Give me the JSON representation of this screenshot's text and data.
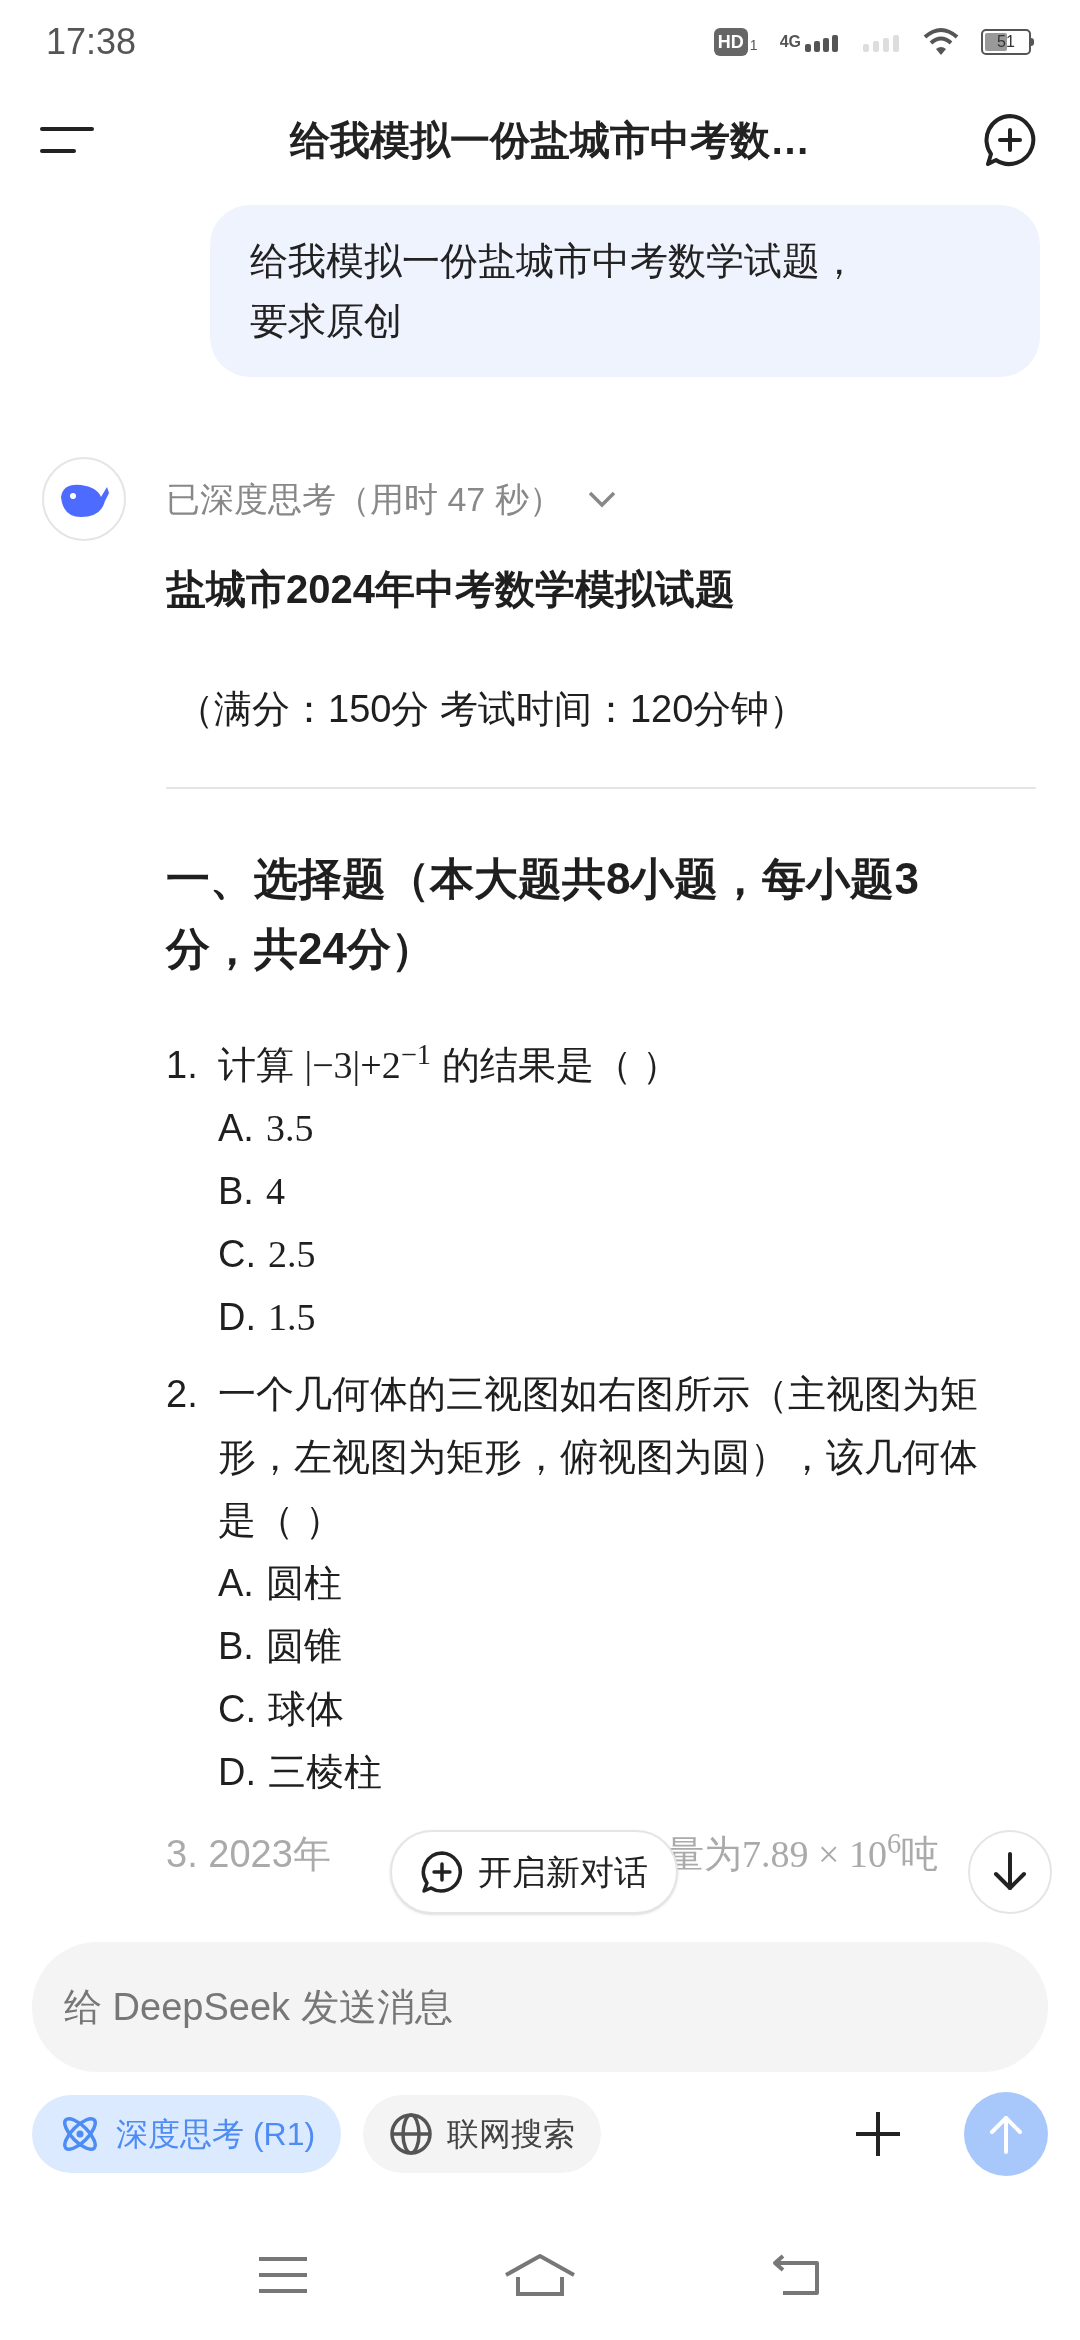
{
  "status_bar": {
    "time": "17:38",
    "hd": "HD",
    "hd_sub": "1",
    "network": "4G",
    "battery": "51"
  },
  "header": {
    "title": "给我模拟一份盐城市中考数…"
  },
  "user_message": {
    "text": "给我模拟一份盐城市中考数学试题，要求原创"
  },
  "reply": {
    "thinking": {
      "label": "已深度思考（用时 47 秒）",
      "expanded": false
    },
    "title": "盐城市2024年中考数学模拟试题",
    "subtitle": "（满分：150分 考试时间：120分钟）",
    "section": "一、选择题（本大题共8小题，每小题3分，共24分）",
    "questions": [
      {
        "number": "1.",
        "parts": [
          {
            "kind": "text",
            "text": "计算 "
          },
          {
            "kind": "math",
            "text": "|−3|+2$^{−1}$"
          },
          {
            "kind": "text",
            "text": " 的结果是（ ）"
          }
        ],
        "options": [
          {
            "label": "A.",
            "kind": "math",
            "text": "3.5"
          },
          {
            "label": "B.",
            "kind": "math",
            "text": "4"
          },
          {
            "label": "C.",
            "kind": "math",
            "text": "2.5"
          },
          {
            "label": "D.",
            "kind": "math",
            "text": "1.5"
          }
        ]
      },
      {
        "number": "2.",
        "parts": [
          {
            "kind": "text",
            "text": "一个几何体的三视图如右图所示（主视图为矩形，左视图为矩形，俯视图为圆），该几何体是（ ）"
          }
        ],
        "options": [
          {
            "label": "A.",
            "kind": "text",
            "text": "圆柱"
          },
          {
            "label": "B.",
            "kind": "text",
            "text": "圆锥"
          },
          {
            "label": "C.",
            "kind": "text",
            "text": "球体"
          },
          {
            "label": "D.",
            "kind": "text",
            "text": "三棱柱"
          }
        ]
      }
    ],
    "cut_question": {
      "left": "3. 2023年",
      "right": "量为7.89 × 10$^{6}$吨"
    }
  },
  "new_chat_button": {
    "label": "开启新对话"
  },
  "composer": {
    "placeholder": "给 DeepSeek 发送消息",
    "toggles": [
      {
        "label": "深度思考 (R1)",
        "kind": "atom",
        "selected": true
      },
      {
        "label": "联网搜索",
        "kind": "globe",
        "selected": false
      }
    ],
    "send_disabled": true
  }
}
